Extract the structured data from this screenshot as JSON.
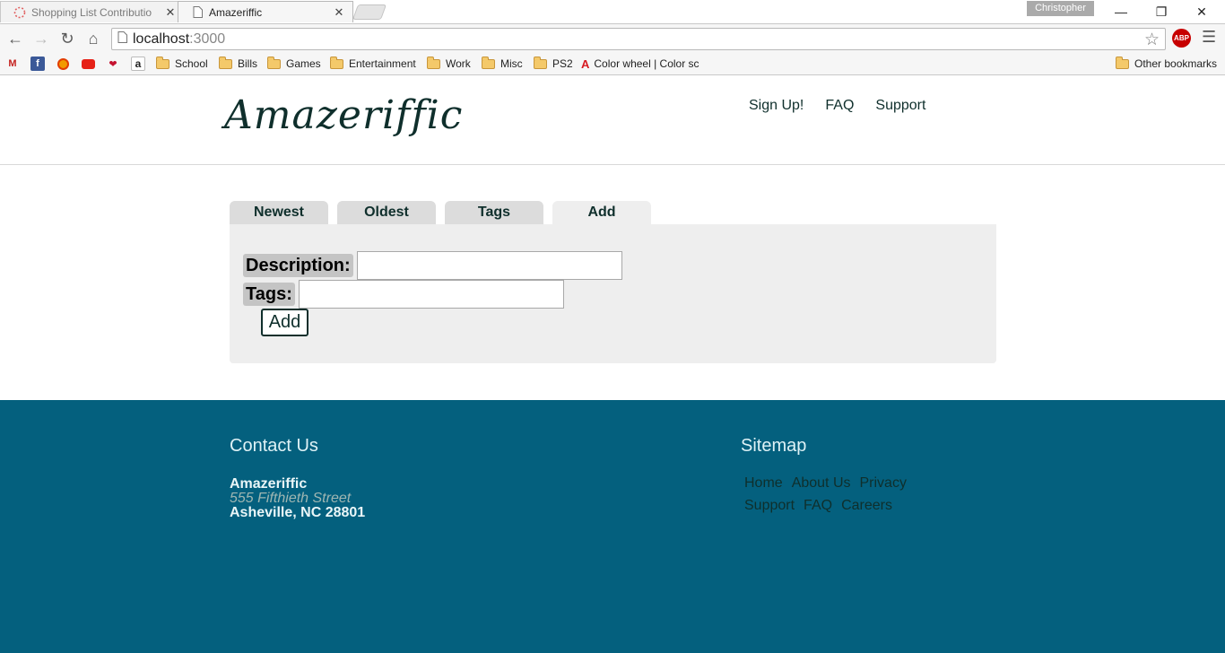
{
  "browser": {
    "tabs": [
      {
        "title": "Shopping List Contributio",
        "active": false
      },
      {
        "title": "Amazeriffic",
        "active": true
      }
    ],
    "profile_name": "Christopher",
    "url_host": "localhost",
    "url_port": ":3000",
    "abp_label": "ABP",
    "bookmarks": [
      {
        "icon": "gmail-icon"
      },
      {
        "icon": "facebook-icon"
      },
      {
        "icon": "orange-circle-icon"
      },
      {
        "icon": "youtube-icon"
      },
      {
        "icon": "red-bird-icon"
      },
      {
        "icon": "amazon-icon"
      },
      {
        "label": "School"
      },
      {
        "label": "Bills"
      },
      {
        "label": "Games"
      },
      {
        "label": "Entertainment"
      },
      {
        "label": "Work"
      },
      {
        "label": "Misc"
      },
      {
        "label": "PS2"
      },
      {
        "label": "Color wheel | Color sc"
      }
    ],
    "other_bookmarks": "Other bookmarks"
  },
  "header": {
    "logo": "Amazeriffic",
    "nav": [
      "Sign Up!",
      "FAQ",
      "Support"
    ]
  },
  "tabs": [
    "Newest",
    "Oldest",
    "Tags",
    "Add"
  ],
  "active_tab": "Add",
  "form": {
    "description_label": "Description:",
    "description_value": "",
    "tags_label": "Tags:",
    "tags_value": "",
    "add_button": "Add"
  },
  "footer": {
    "contact_title": "Contact Us",
    "company": "Amazeriffic",
    "street": "555 Fifthieth Street",
    "city": "Asheville, NC 28801",
    "sitemap_title": "Sitemap",
    "sitemap_row1": [
      "Home",
      "About Us",
      "Privacy"
    ],
    "sitemap_row2": [
      "Support",
      "FAQ",
      "Careers"
    ]
  }
}
